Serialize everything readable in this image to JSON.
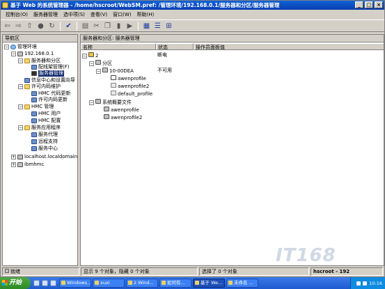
{
  "window": {
    "title": "基于 Web 的系统管理器 - /home/hscroot/WebSM.pref: /管理环境/192.168.0.1/服务器和分区/服务器管理",
    "controls": [
      "_",
      "□",
      "×"
    ]
  },
  "menubar": {
    "items": [
      "控制台(O)",
      "服务器管理",
      "选中项(S)",
      "查看(V)",
      "窗口(W)",
      "帮助(H)"
    ]
  },
  "navigation": {
    "header": "导航区",
    "tree": [
      {
        "label": "管理环境",
        "icon": "globe-icon"
      },
      {
        "label": "192.168.0.1",
        "icon": "host-icon"
      },
      {
        "label": "服务器和分区",
        "icon": "folder-icon"
      },
      {
        "label": "配线架管理(F)",
        "icon": "rack-icon"
      },
      {
        "label": "服务器管理",
        "icon": "server-icon",
        "selected": true
      },
      {
        "label": "信息中心和设置向导",
        "icon": "info-icon"
      },
      {
        "label": "许可内码维护",
        "icon": "folder-icon"
      },
      {
        "label": "HMC 代码更新",
        "icon": "update-icon"
      },
      {
        "label": "许可内码更新",
        "icon": "update-icon"
      },
      {
        "label": "HMC 管理",
        "icon": "folder-icon"
      },
      {
        "label": "HMC 用户",
        "icon": "users-icon"
      },
      {
        "label": "HMC 配置",
        "icon": "config-icon"
      },
      {
        "label": "服务应用程序",
        "icon": "folder-icon"
      },
      {
        "label": "服务代理",
        "icon": "wrench-icon"
      },
      {
        "label": "远程支持",
        "icon": "wrench-icon"
      },
      {
        "label": "服务中心",
        "icon": "wrench-icon"
      },
      {
        "label": "localhost.localdomain",
        "icon": "host-icon"
      },
      {
        "label": "ibmhmc",
        "icon": "host-icon"
      }
    ]
  },
  "content": {
    "header": "服务器和分区: 服务器管理",
    "columns": [
      "名称",
      "状态",
      "操作员面板值"
    ],
    "rows": [
      {
        "name": "2",
        "status": "断电",
        "panel": ""
      },
      {
        "name": "分区",
        "status": "",
        "panel": ""
      },
      {
        "name": "10-00DEA",
        "status": "不可用",
        "panel": ""
      },
      {
        "name": "awenprofile",
        "status": "",
        "panel": ""
      },
      {
        "name": "awenprofile2",
        "status": "",
        "panel": ""
      },
      {
        "name": "default_profile",
        "status": "",
        "panel": ""
      },
      {
        "name": "系统概要文件",
        "status": "",
        "panel": ""
      },
      {
        "name": "awenprofile",
        "status": "",
        "panel": ""
      },
      {
        "name": "awenprofile2",
        "status": "",
        "panel": ""
      }
    ]
  },
  "statusbar": {
    "ready": "就绪",
    "shown": "显示 9 个对象，隐藏 0 个对象",
    "selected": "选择了 0 个对象",
    "user": "hscroot - 192"
  },
  "taskbar": {
    "start": "开始",
    "tasks": [
      "Windows...",
      "xuxi",
      "2 Wind...",
      "如何有...",
      "基于 We...",
      "未命名 ..."
    ],
    "clock": "10:16"
  }
}
